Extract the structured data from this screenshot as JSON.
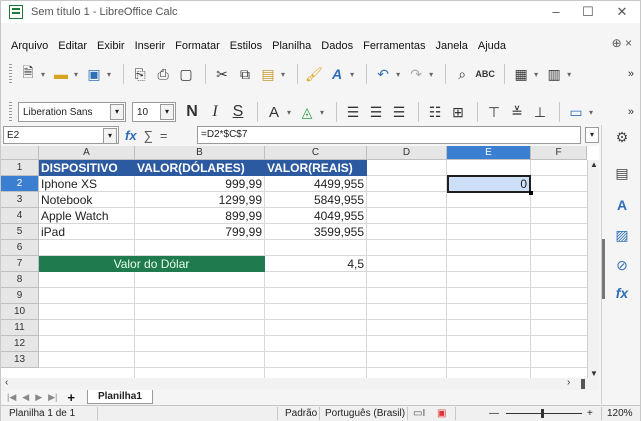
{
  "window": {
    "title": "Sem título 1 - LibreOffice Calc",
    "controls": {
      "minimize": "–",
      "maximize": "☐",
      "close": "✕"
    }
  },
  "menu": {
    "items": [
      "Arquivo",
      "Editar",
      "Exibir",
      "Inserir",
      "Formatar",
      "Estilos",
      "Planilha",
      "Dados",
      "Ferramentas",
      "Janela",
      "Ajuda"
    ],
    "extra": "⊕ ×"
  },
  "toolbar_format": {
    "font_name": "Liberation Sans",
    "font_size": "10",
    "bold": "N",
    "italic": "I",
    "underline": "S",
    "font_color": "A",
    "more": "»"
  },
  "formula_bar": {
    "name_box": "E2",
    "fx": "fx",
    "sum": "∑",
    "equals": "=",
    "formula": "=D2*$C$7"
  },
  "grid": {
    "columns": [
      "A",
      "B",
      "C",
      "D",
      "E",
      "F"
    ],
    "rows": [
      "1",
      "2",
      "3",
      "4",
      "5",
      "6",
      "7",
      "8",
      "9",
      "10",
      "11",
      "12",
      "13"
    ],
    "header": {
      "a": "DISPOSITIVO",
      "b": "VALOR(DÓLARES)",
      "c": "VALOR(REAIS)"
    },
    "items": [
      {
        "name": "Iphone XS",
        "usd": "999,99",
        "brl": "4499,955"
      },
      {
        "name": "Notebook",
        "usd": "1299,99",
        "brl": "5849,955"
      },
      {
        "name": "Apple Watch",
        "usd": "899,99",
        "brl": "4049,955"
      },
      {
        "name": "iPad",
        "usd": "799,99",
        "brl": "3599,955"
      }
    ],
    "dolar_label": "Valor do Dólar",
    "dolar_value": "4,5",
    "selected_value": "0"
  },
  "sheets": {
    "active": "Planilha1",
    "add": "+"
  },
  "status": {
    "sheet_info": "Planilha 1 de 1",
    "style": "Padrão",
    "language": "Português (Brasil)",
    "zoom_minus": "—",
    "zoom_plus": "+",
    "zoom": "120%"
  },
  "colors": {
    "header_fill": "#2c5aa0",
    "dolar_fill": "#1f7a4d",
    "selection": "#3b7fd3"
  }
}
